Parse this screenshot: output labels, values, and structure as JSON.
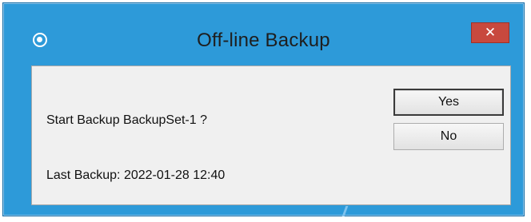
{
  "window": {
    "title": "Off-line Backup",
    "app_icon": "app-circle-icon",
    "close_glyph": "✕",
    "close_icon": "close-icon",
    "frame_color": "#2d9ad9",
    "close_color": "#c8493e"
  },
  "dialog": {
    "prompt": "Start Backup BackupSet-1 ?",
    "last_backup": "Last Backup: 2022-01-28 12:40",
    "buttons": {
      "yes_label": "Yes",
      "no_label": "No"
    }
  }
}
